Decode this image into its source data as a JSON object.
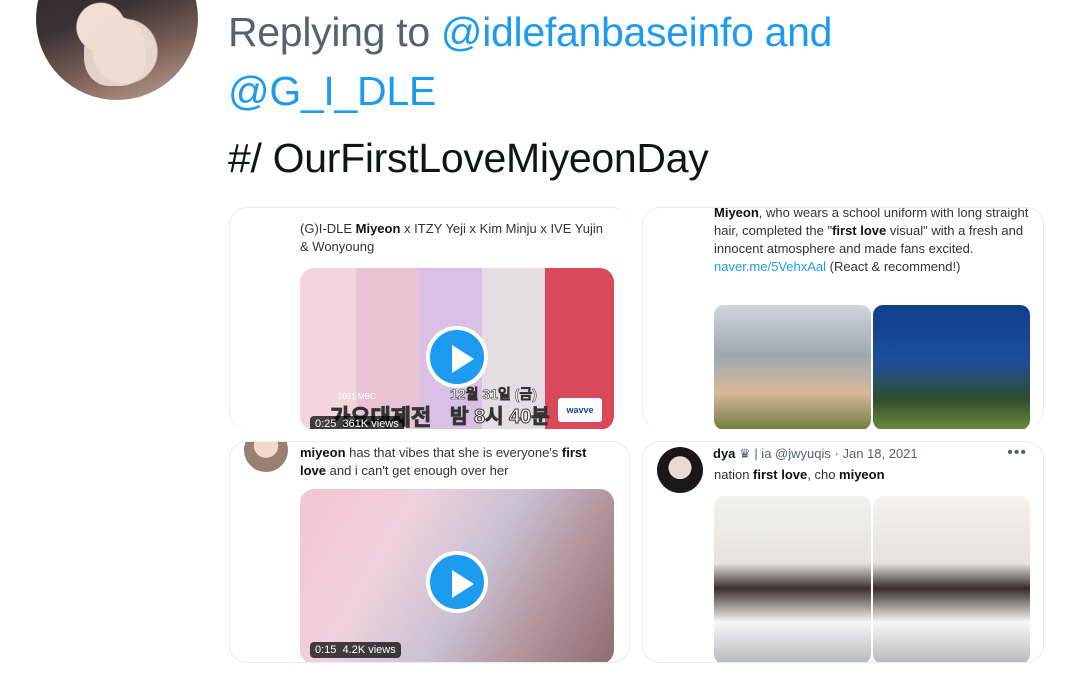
{
  "reply": {
    "prefix": "Replying to",
    "mention1": "@idlefanbaseinfo",
    "and": "and",
    "mention2": "@G_I_DLE"
  },
  "hashtag": "#/ OurFirstLoveMiyeonDay",
  "quotes": [
    {
      "text_pre": "(G)I-DLE ",
      "text_bold": "Miyeon",
      "text_post": " x ITZY Yeji x Kim Minju x IVE Yujin & Wonyoung",
      "media_type": "video",
      "duration": "0:25",
      "views": "361K views",
      "overlay_title": "가요대제전",
      "overlay_date": "12월 31일 (금)",
      "overlay_time": "밤 8시 40분",
      "overlay_year": "2021 MBC",
      "overlay_logo": "wavve"
    },
    {
      "text_bold": "Miyeon",
      "text_mid": ", who wears a school uniform with long straight hair, completed the \"",
      "text_bold2": "first love",
      "text_mid2": " visual\" with a fresh and innocent atmosphere and made fans excited.",
      "link": "naver.me/5VehxAal",
      "link_suffix": " (React & recommend!)",
      "media_type": "photos"
    },
    {
      "text_bold": "miyeon",
      "text_mid": " has that vibes that she is everyone's ",
      "text_bold2": "first love",
      "text_mid2": " and i can't get enough over her",
      "media_type": "video",
      "duration": "0:15",
      "views": "4.2K views"
    },
    {
      "author": "dya",
      "author_suffix": " | ia",
      "handle": "@jwyuqis",
      "date": "Jan 18, 2021",
      "more": "•••",
      "text_pre": "nation ",
      "text_bold": "first love",
      "text_mid": ", cho ",
      "text_bold2": "miyeon",
      "media_type": "photos"
    }
  ],
  "colors": {
    "accent": "#1d9bf0",
    "secondary_text": "#536471",
    "primary_text": "#0f1419"
  }
}
